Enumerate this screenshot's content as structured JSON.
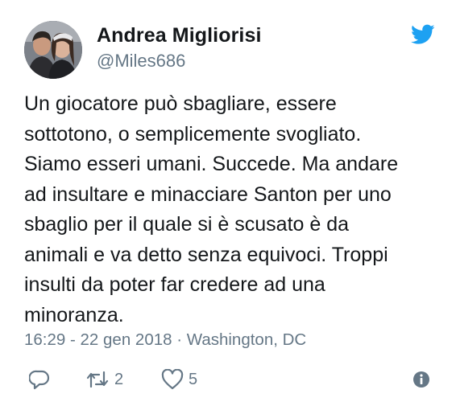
{
  "user": {
    "display_name": "Andrea Migliorisi",
    "handle": "@Miles686"
  },
  "tweet": {
    "text": "Un giocatore può sbagliare, essere\nsottotono, o semplicemente svogliato.\nSiamo esseri umani. Succede. Ma andare\nad insultare e minacciare Santon per uno\nsbaglio per il quale si è scusato è da\nanimali e va detto senza equivoci. Troppi\ninsulti da poter far credere ad una\nminoranza.",
    "timestamp": "16:29 - 22 gen 2018 · Washington, DC"
  },
  "actions": {
    "retweet_count": "2",
    "like_count": "5"
  },
  "colors": {
    "twitter_blue": "#1da1f2",
    "text_primary": "#14171a",
    "text_secondary": "#657786",
    "icon_gray": "#657786"
  },
  "icons": {
    "brand": "twitter-bird-icon",
    "reply": "reply-icon",
    "retweet": "retweet-icon",
    "like": "heart-icon",
    "info": "info-icon"
  }
}
